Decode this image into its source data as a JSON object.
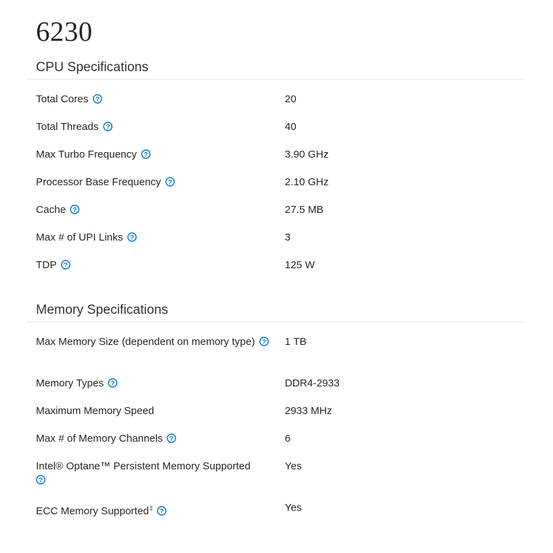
{
  "title": "6230",
  "help_icon": "help-circle-icon",
  "colors": {
    "help_icon": "#0071c5",
    "rule": "#e5e5e5"
  },
  "sections": [
    {
      "header": "CPU Specifications",
      "rows": [
        {
          "label": "Total Cores",
          "value": "20"
        },
        {
          "label": "Total Threads",
          "value": "40"
        },
        {
          "label": "Max Turbo Frequency",
          "value": "3.90 GHz"
        },
        {
          "label": "Processor Base Frequency",
          "value": "2.10 GHz"
        },
        {
          "label": "Cache",
          "value": "27.5 MB"
        },
        {
          "label": "Max # of UPI Links",
          "value": "3"
        },
        {
          "label": "TDP",
          "value": "125 W"
        }
      ]
    },
    {
      "header": "Memory Specifications",
      "rows": [
        {
          "label": "Max Memory Size (dependent on memory type)",
          "value": "1 TB"
        },
        {
          "label": "Memory Types",
          "value": "DDR4-2933"
        },
        {
          "label": "Maximum Memory Speed",
          "value": "2933 MHz"
        },
        {
          "label": "Max # of Memory Channels",
          "value": "6"
        },
        {
          "label": "Intel® Optane™ Persistent Memory Supported",
          "value": "Yes"
        },
        {
          "label": "ECC Memory Supported",
          "label_sup": "‡",
          "value": "Yes"
        }
      ]
    }
  ]
}
